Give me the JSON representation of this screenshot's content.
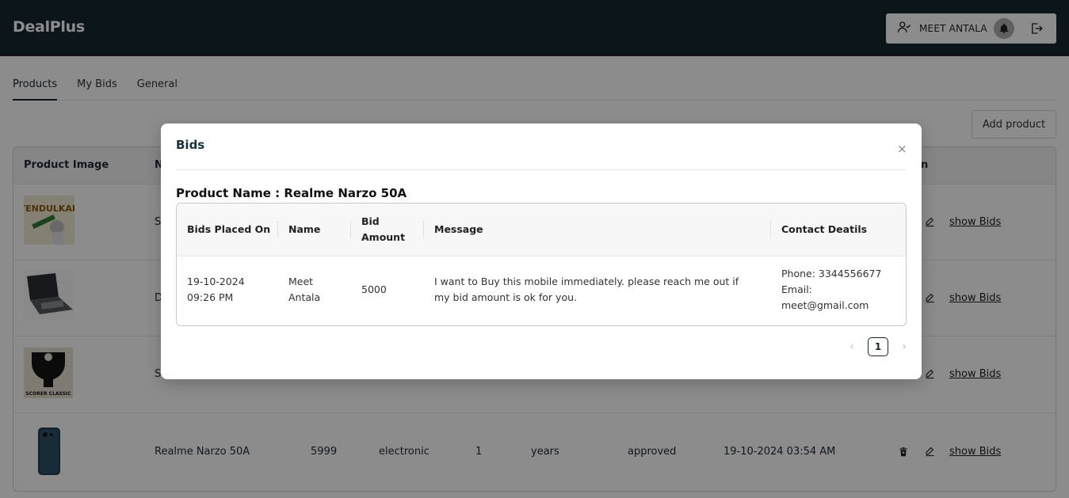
{
  "app": {
    "brand": "DealPlus"
  },
  "header": {
    "user_name": "MEET ANTALA"
  },
  "tabs": [
    {
      "label": "Products",
      "active": true
    },
    {
      "label": "My Bids",
      "active": false
    },
    {
      "label": "General",
      "active": false
    }
  ],
  "toolbar": {
    "add_product_label": "Add product"
  },
  "products_table": {
    "columns": {
      "image": "Product Image",
      "name_partial": "N",
      "action_partial": "n"
    },
    "rows": [
      {
        "image": "tendulkar-book",
        "name": "S",
        "action": "show Bids"
      },
      {
        "image": "laptop",
        "name": "D",
        "action": "show Bids"
      },
      {
        "image": "scorer-classic",
        "name": "S",
        "action": "show Bids"
      },
      {
        "image": "phone",
        "name": "Realme Narzo 50A",
        "price": "5999",
        "category": "electronic",
        "age": "1",
        "unit": "years",
        "status": "approved",
        "date": "19-10-2024 03:54 AM",
        "action": "show Bids"
      }
    ]
  },
  "modal": {
    "title": "Bids",
    "close_symbol": "×",
    "product_name_line": "Product Name : Realme Narzo 50A",
    "columns": {
      "placed_on": "Bids Placed On",
      "name": "Name",
      "bid_amount_line1": "Bid",
      "bid_amount_line2": "Amount",
      "message": "Message",
      "contact": "Contact Deatils"
    },
    "row": {
      "date": "19-10-2024",
      "time": "09:26 PM",
      "first_name": "Meet",
      "last_name": "Antala",
      "amount": "5000",
      "message_line1": "I want to Buy this mobile immediately. please reach me out if",
      "message_line2": "my bid amount is ok for you.",
      "phone": "Phone: 3344556677",
      "email_label": "Email:",
      "email": "meet@gmail.com"
    },
    "pagination": {
      "current_page": "1",
      "prev": "‹",
      "next": "›"
    }
  },
  "colors": {
    "header_bg": "#17272f",
    "overlay": "rgba(0,0,0,0.45)"
  }
}
